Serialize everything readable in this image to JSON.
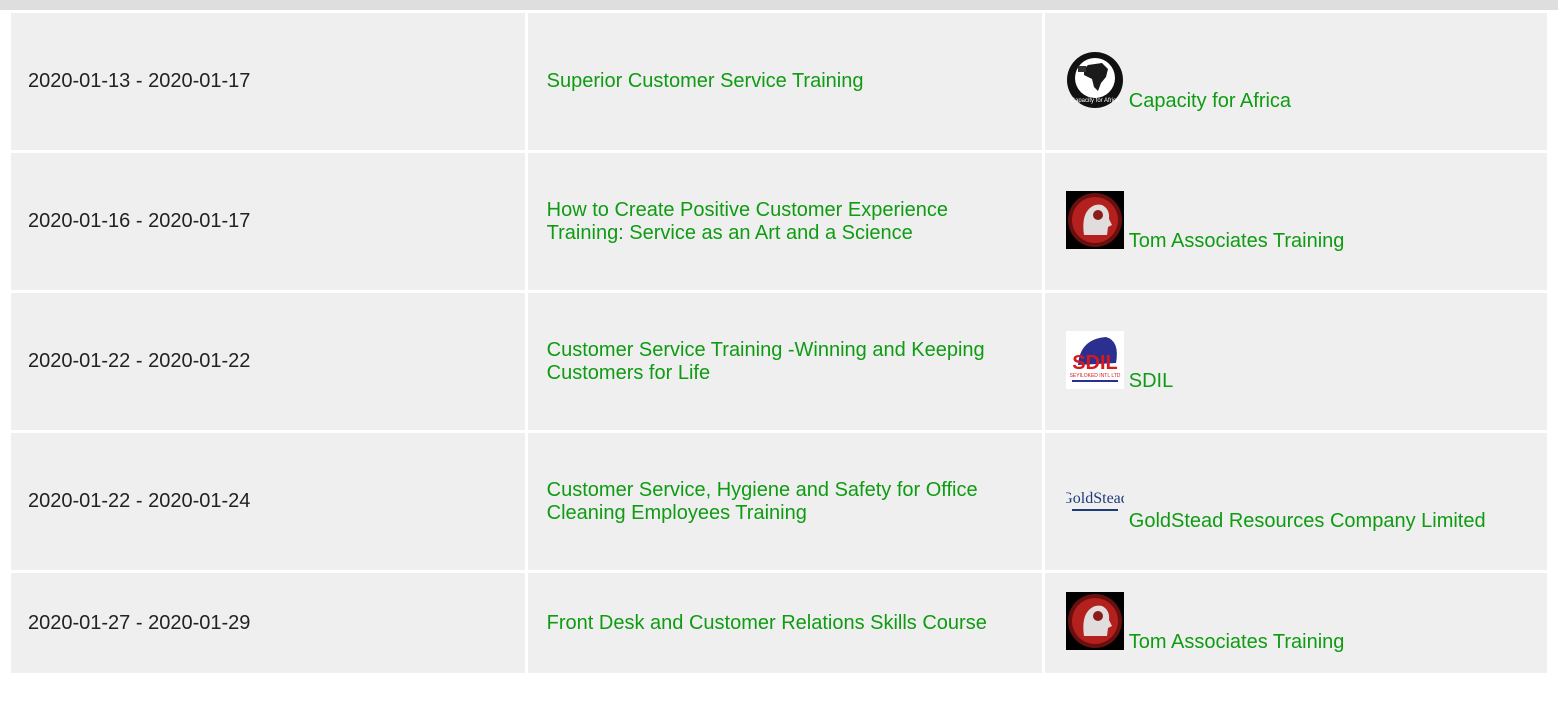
{
  "rows": [
    {
      "date": "2020-01-13 - 2020-01-17",
      "course": "Superior Customer Service Training",
      "provider": "Capacity for Africa",
      "logo": "capacity-for-africa-logo",
      "logo_text": "Capacity for Africa"
    },
    {
      "date": "2020-01-16 - 2020-01-17",
      "course": "How to Create Positive Customer Experience Training: Service as an Art and a Science",
      "provider": "Tom Associates Training",
      "logo": "tom-associates-logo"
    },
    {
      "date": "2020-01-22 - 2020-01-22",
      "course": "Customer Service Training -Winning and Keeping Customers for Life",
      "provider": "SDIL",
      "logo": "sdil-logo",
      "logo_text": "SDIL",
      "logo_sub": "SEYILOKED INTL LTD"
    },
    {
      "date": "2020-01-22 - 2020-01-24",
      "course": "Customer Service, Hygiene and Safety for Office Cleaning Employees Training",
      "provider": "GoldStead Resources Company Limited",
      "logo": "goldstead-logo",
      "logo_text": "GoldStead"
    },
    {
      "date": "2020-01-27 - 2020-01-29",
      "course": "Front Desk and Customer Relations Skills Course",
      "provider": "Tom Associates Training",
      "logo": "tom-associates-logo"
    }
  ],
  "colors": {
    "link": "#0f9b12",
    "cell_bg": "#efefef",
    "top_bar": "#dedede"
  }
}
